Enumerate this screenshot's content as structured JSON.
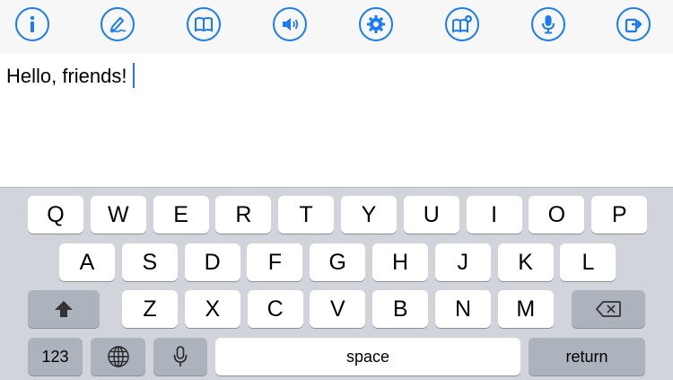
{
  "toolbar": {
    "accent_color": "#1a7cf5",
    "buttons": [
      {
        "name": "info-icon"
      },
      {
        "name": "handwriting-icon"
      },
      {
        "name": "book-icon"
      },
      {
        "name": "speaker-icon"
      },
      {
        "name": "gear-icon"
      },
      {
        "name": "book-add-icon"
      },
      {
        "name": "microphone-icon"
      },
      {
        "name": "share-icon"
      }
    ]
  },
  "editor": {
    "text": "Hello, friends!",
    "caret_color": "#2b6ef2"
  },
  "keyboard": {
    "row1": [
      "Q",
      "W",
      "E",
      "R",
      "T",
      "Y",
      "U",
      "I",
      "O",
      "P"
    ],
    "row2": [
      "A",
      "S",
      "D",
      "F",
      "G",
      "H",
      "J",
      "K",
      "L"
    ],
    "row3": [
      "Z",
      "X",
      "C",
      "V",
      "B",
      "N",
      "M"
    ],
    "numbers_label": "123",
    "space_label": "space",
    "return_label": "return",
    "shift_icon": "shift-icon",
    "delete_icon": "delete-icon",
    "globe_icon": "globe-icon",
    "mic_icon": "microphone-icon"
  }
}
